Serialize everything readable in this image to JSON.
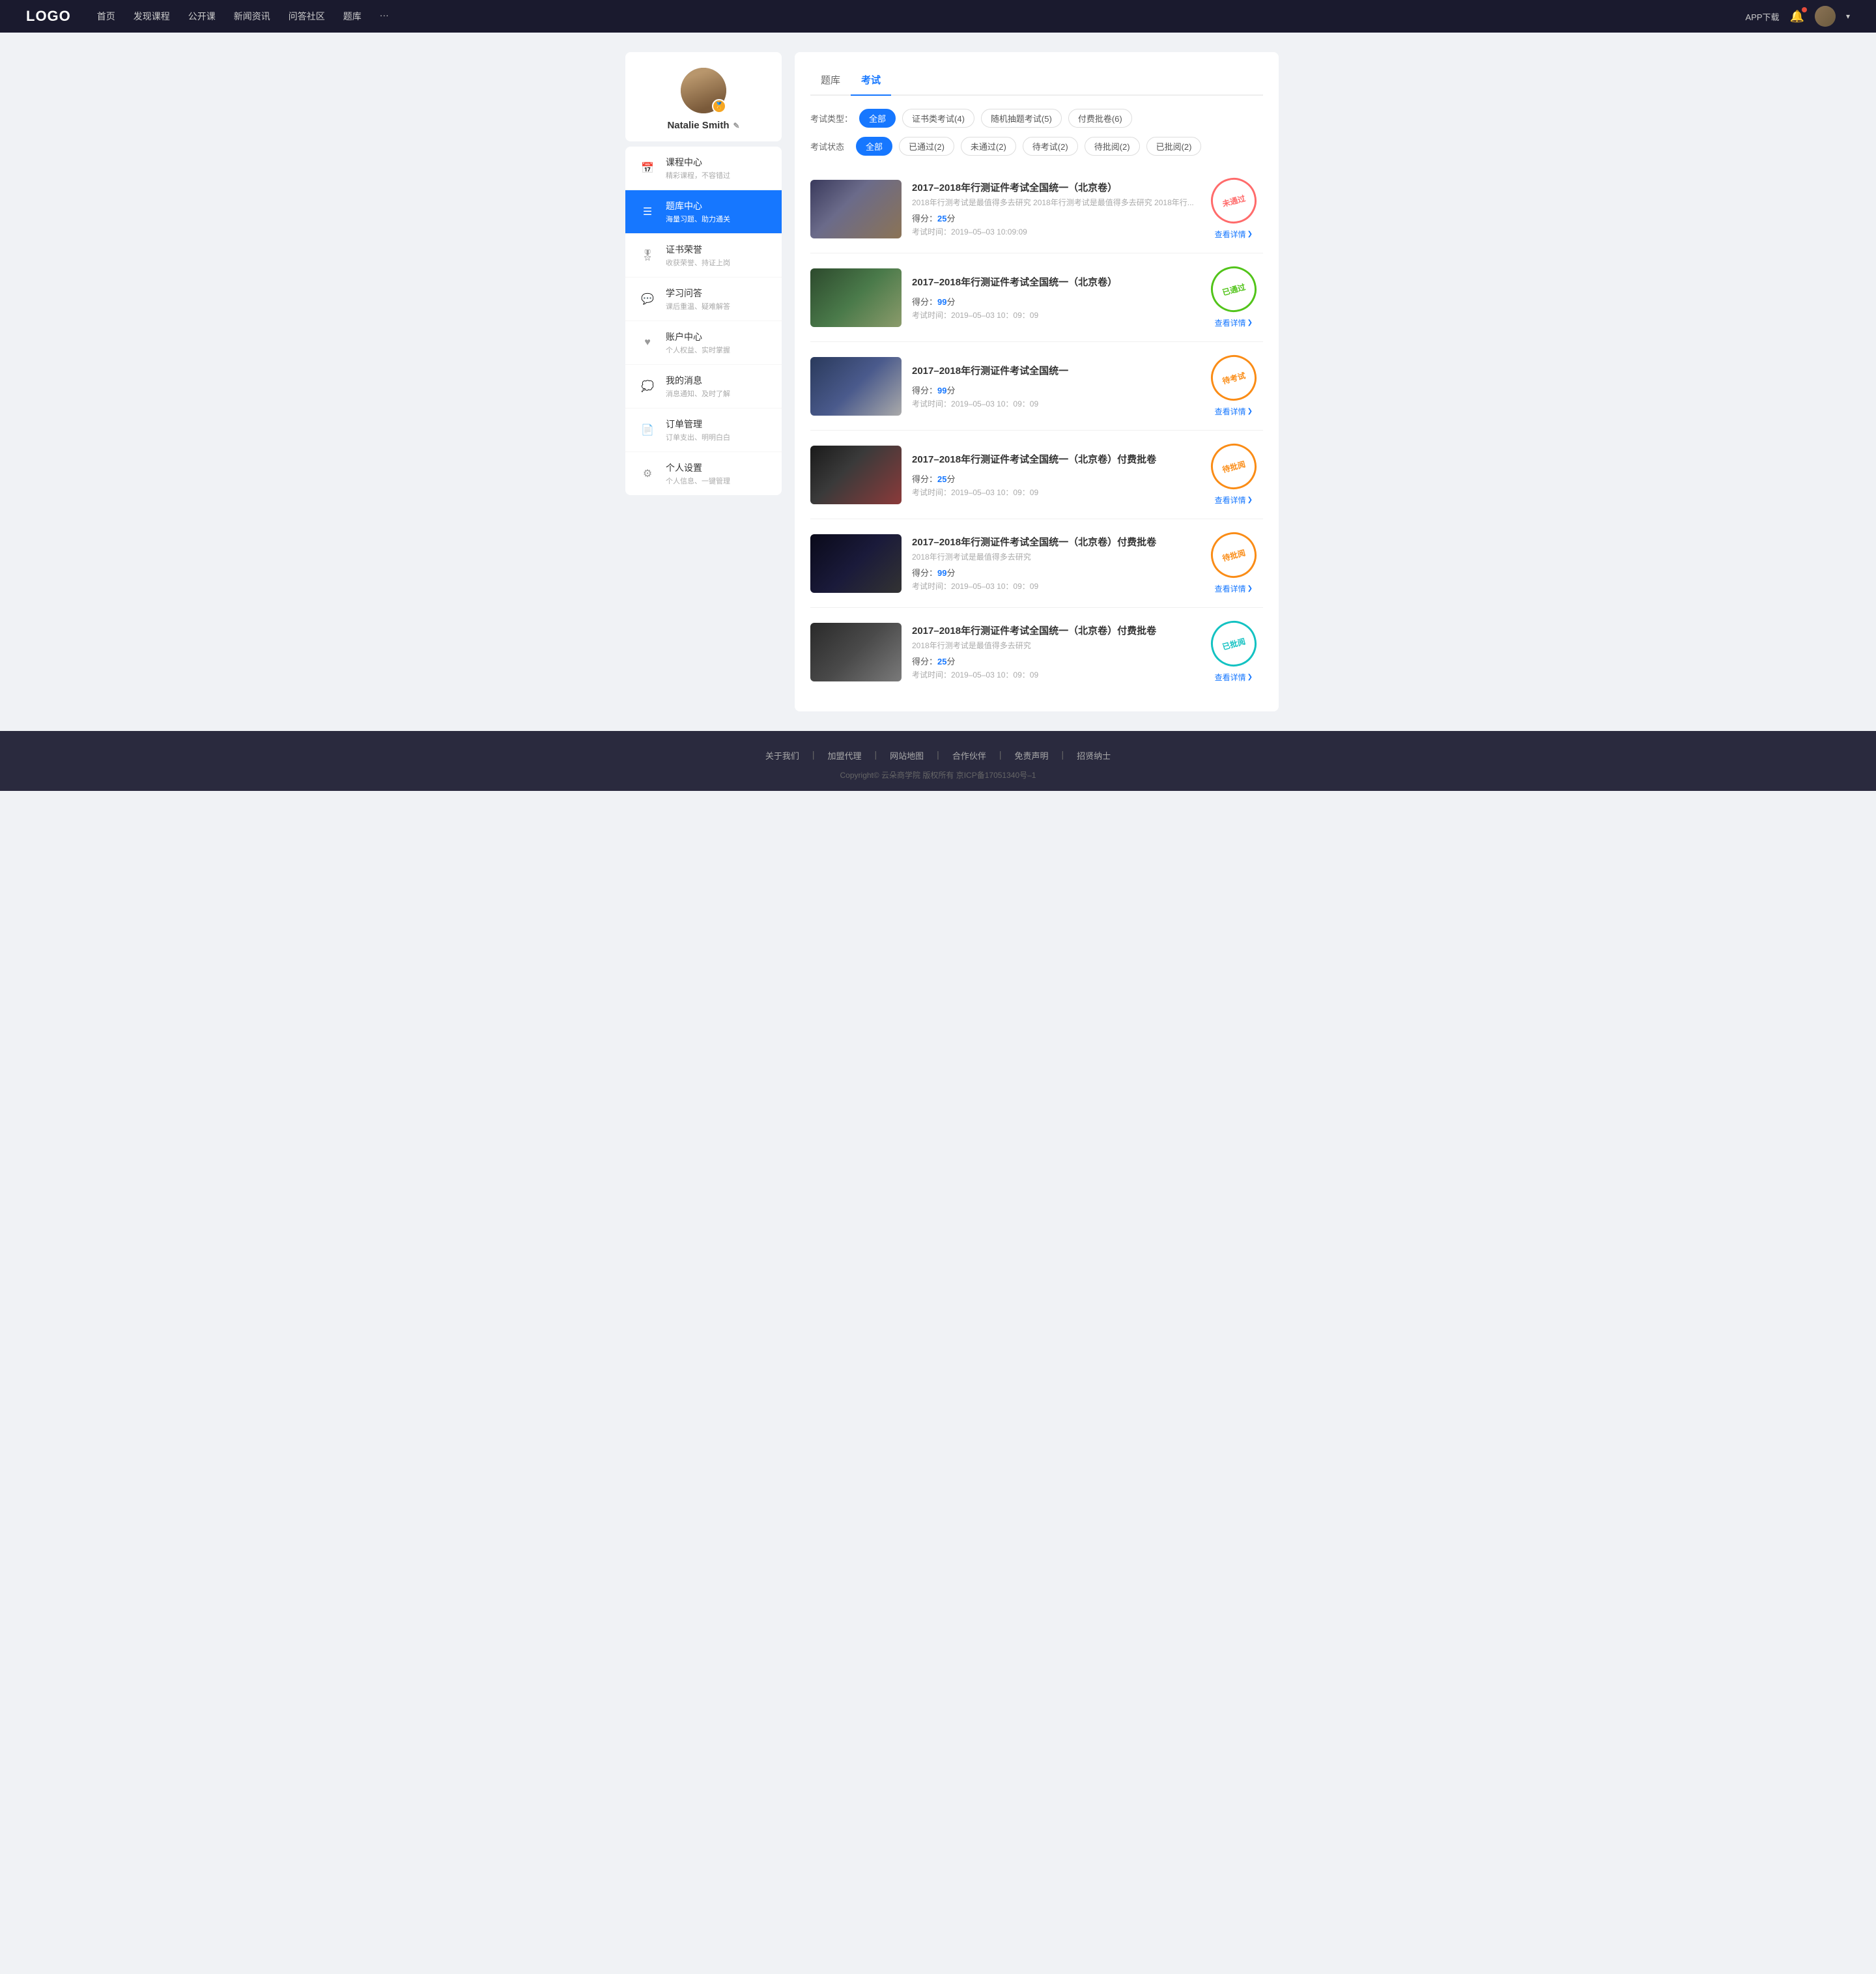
{
  "navbar": {
    "logo": "LOGO",
    "nav_items": [
      {
        "label": "首页",
        "href": "#"
      },
      {
        "label": "发现课程",
        "href": "#"
      },
      {
        "label": "公开课",
        "href": "#"
      },
      {
        "label": "新闻资讯",
        "href": "#"
      },
      {
        "label": "问答社区",
        "href": "#"
      },
      {
        "label": "题库",
        "href": "#"
      },
      {
        "label": "···",
        "href": "#"
      }
    ],
    "app_download": "APP下载",
    "dropdown_arrow": "▾"
  },
  "sidebar": {
    "profile": {
      "name": "Natalie Smith",
      "edit_icon": "✎",
      "badge": "🏅"
    },
    "menu_items": [
      {
        "icon": "📅",
        "label": "课程中心",
        "sub": "精彩课程，不容错过",
        "active": false
      },
      {
        "icon": "☰",
        "label": "题库中心",
        "sub": "海量习题、助力通关",
        "active": true
      },
      {
        "icon": "🎖",
        "label": "证书荣誉",
        "sub": "收获荣誉、持证上岗",
        "active": false
      },
      {
        "icon": "💬",
        "label": "学习问答",
        "sub": "课后重温、疑难解答",
        "active": false
      },
      {
        "icon": "♥",
        "label": "账户中心",
        "sub": "个人权益、实时掌握",
        "active": false
      },
      {
        "icon": "💭",
        "label": "我的消息",
        "sub": "消息通知、及时了解",
        "active": false
      },
      {
        "icon": "📄",
        "label": "订单管理",
        "sub": "订单支出、明明白白",
        "active": false
      },
      {
        "icon": "⚙",
        "label": "个人设置",
        "sub": "个人信息、一键管理",
        "active": false
      }
    ]
  },
  "content": {
    "tabs": [
      {
        "label": "题库",
        "active": false
      },
      {
        "label": "考试",
        "active": true
      }
    ],
    "filter_type": {
      "label": "考试类型：",
      "options": [
        {
          "label": "全部",
          "active": true
        },
        {
          "label": "证书类考试(4)",
          "active": false
        },
        {
          "label": "随机抽题考试(5)",
          "active": false
        },
        {
          "label": "付费批卷(6)",
          "active": false
        }
      ]
    },
    "filter_status": {
      "label": "考试状态",
      "options": [
        {
          "label": "全部",
          "active": true
        },
        {
          "label": "已通过(2)",
          "active": false
        },
        {
          "label": "未通过(2)",
          "active": false
        },
        {
          "label": "待考试(2)",
          "active": false
        },
        {
          "label": "待批阅(2)",
          "active": false
        },
        {
          "label": "已批阅(2)",
          "active": false
        }
      ]
    },
    "exams": [
      {
        "title": "2017–2018年行测证件考试全国统一（北京卷）",
        "desc": "2018年行测考试是最值得多去研究 2018年行测考试是最值得多去研究 2018年行...",
        "score_label": "得分：",
        "score": "25",
        "score_unit": "分",
        "time_label": "考试时间：",
        "time": "2019–05–03  10:09:09",
        "status": "未通过",
        "status_class": "not-passed",
        "thumb_class": "thumb-1",
        "view_label": "查看详情"
      },
      {
        "title": "2017–2018年行测证件考试全国统一（北京卷）",
        "desc": "",
        "score_label": "得分：",
        "score": "99",
        "score_unit": "分",
        "time_label": "考试时间：",
        "time": "2019–05–03  10：09：09",
        "status": "已通过",
        "status_class": "passed",
        "thumb_class": "thumb-2",
        "view_label": "查看详情"
      },
      {
        "title": "2017–2018年行测证件考试全国统一",
        "desc": "",
        "score_label": "得分：",
        "score": "99",
        "score_unit": "分",
        "time_label": "考试时间：",
        "time": "2019–05–03  10：09：09",
        "status": "待考试",
        "status_class": "pending",
        "thumb_class": "thumb-3",
        "view_label": "查看详情"
      },
      {
        "title": "2017–2018年行测证件考试全国统一（北京卷）付费批卷",
        "desc": "",
        "score_label": "得分：",
        "score": "25",
        "score_unit": "分",
        "time_label": "考试时间：",
        "time": "2019–05–03  10：09：09",
        "status": "待批阅",
        "status_class": "pending-review",
        "thumb_class": "thumb-4",
        "view_label": "查看详情"
      },
      {
        "title": "2017–2018年行测证件考试全国统一（北京卷）付费批卷",
        "desc": "2018年行测考试是最值得多去研究",
        "score_label": "得分：",
        "score": "99",
        "score_unit": "分",
        "time_label": "考试时间：",
        "time": "2019–05–03  10：09：09",
        "status": "待批阅",
        "status_class": "pending-review",
        "thumb_class": "thumb-5",
        "view_label": "查看详情"
      },
      {
        "title": "2017–2018年行测证件考试全国统一（北京卷）付费批卷",
        "desc": "2018年行测考试是最值得多去研究",
        "score_label": "得分：",
        "score": "25",
        "score_unit": "分",
        "time_label": "考试时间：",
        "time": "2019–05–03  10：09：09",
        "status": "已批阅",
        "status_class": "reviewed",
        "thumb_class": "thumb-6",
        "view_label": "查看详情"
      }
    ]
  },
  "footer": {
    "links": [
      {
        "label": "关于我们"
      },
      {
        "label": "加盟代理"
      },
      {
        "label": "网站地图"
      },
      {
        "label": "合作伙伴"
      },
      {
        "label": "免责声明"
      },
      {
        "label": "招贤纳士"
      }
    ],
    "copyright": "Copyright© 云朵商学院  版权所有    京ICP备17051340号–1"
  }
}
